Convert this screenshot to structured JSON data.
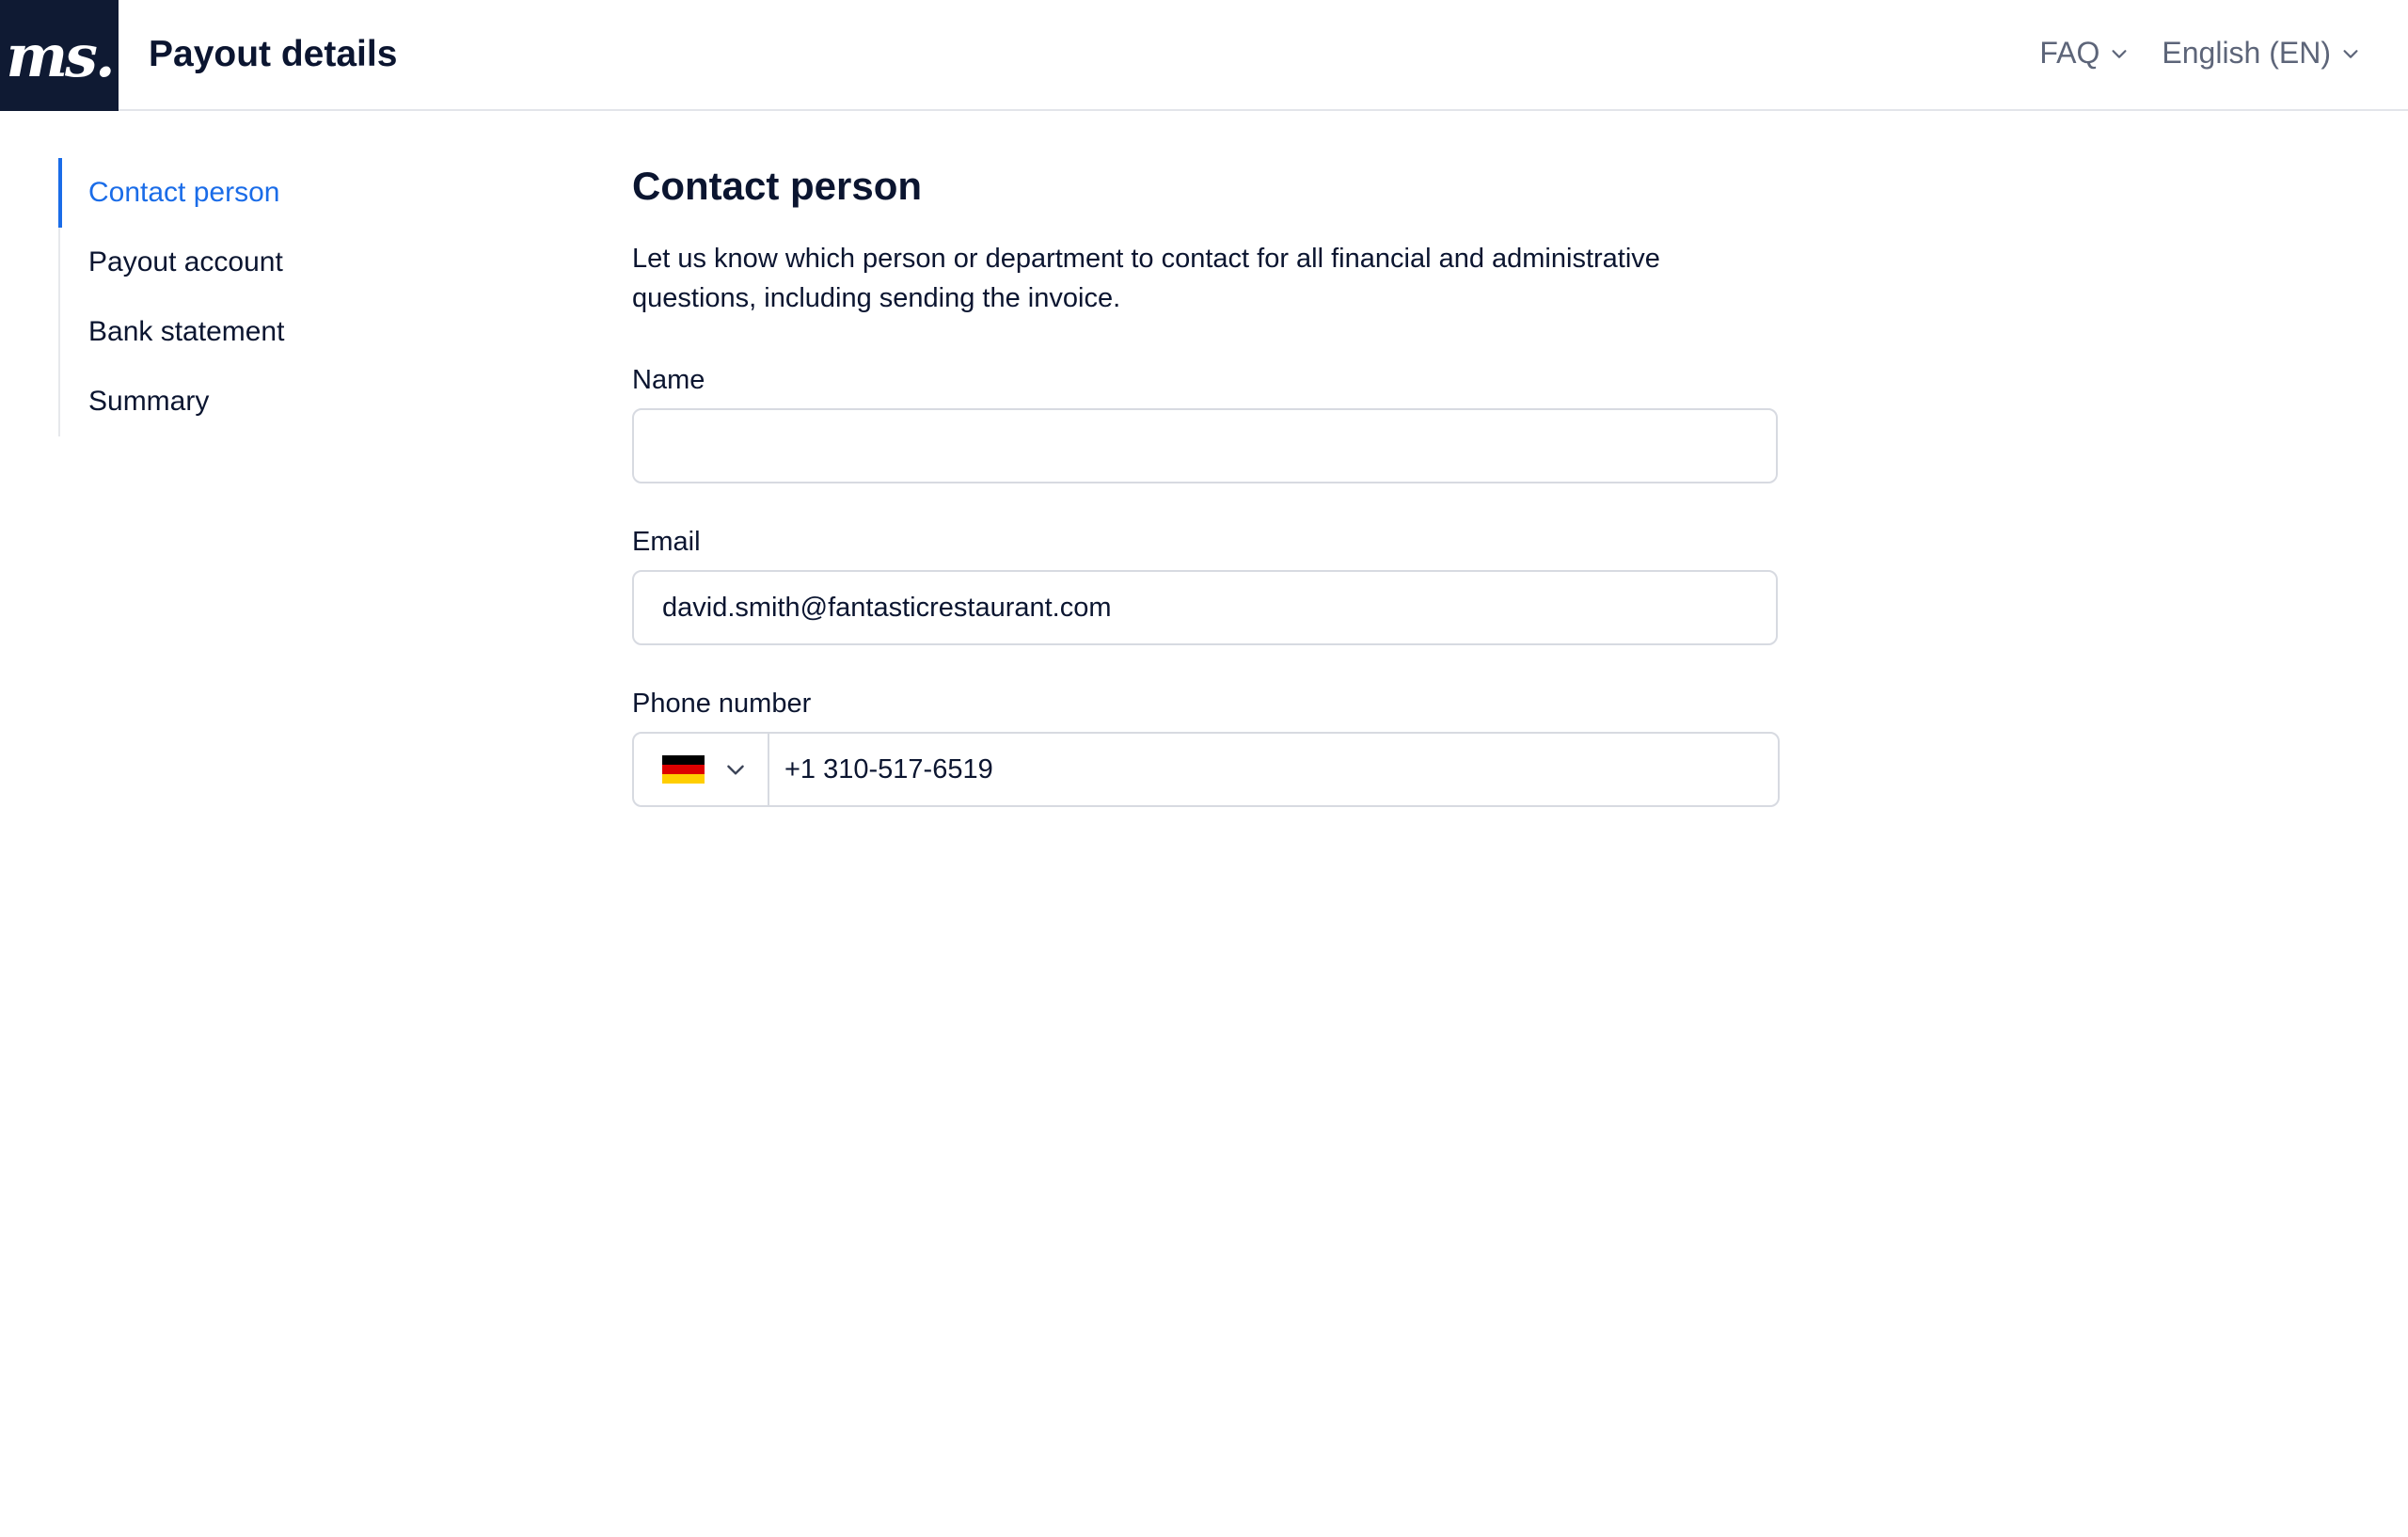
{
  "header": {
    "logo_text": "ms.",
    "title": "Payout details",
    "faq_label": "FAQ",
    "language_label": "English (EN)"
  },
  "sidebar": {
    "items": [
      {
        "label": "Contact person",
        "active": true
      },
      {
        "label": "Payout account",
        "active": false
      },
      {
        "label": "Bank statement",
        "active": false
      },
      {
        "label": "Summary",
        "active": false
      }
    ]
  },
  "main": {
    "title": "Contact person",
    "intro": "Let us know which person or department to contact for all financial and administrative questions, including sending the invoice.",
    "fields": {
      "name": {
        "label": "Name",
        "value": "",
        "placeholder": ""
      },
      "email": {
        "label": "Email",
        "value": "david.smith@fantasticrestaurant.com",
        "placeholder": ""
      },
      "phone": {
        "label": "Phone number",
        "country_flag": "germany-flag",
        "value": "+1 310-517-6519"
      }
    }
  },
  "colors": {
    "accent": "#1a6ce8",
    "logo_bg": "#0f1a33",
    "text": "#0b1530",
    "muted": "#5d6579",
    "border": "#d7dae1",
    "flag_black": "#000000",
    "flag_red": "#dd0000",
    "flag_gold": "#ffce00"
  }
}
